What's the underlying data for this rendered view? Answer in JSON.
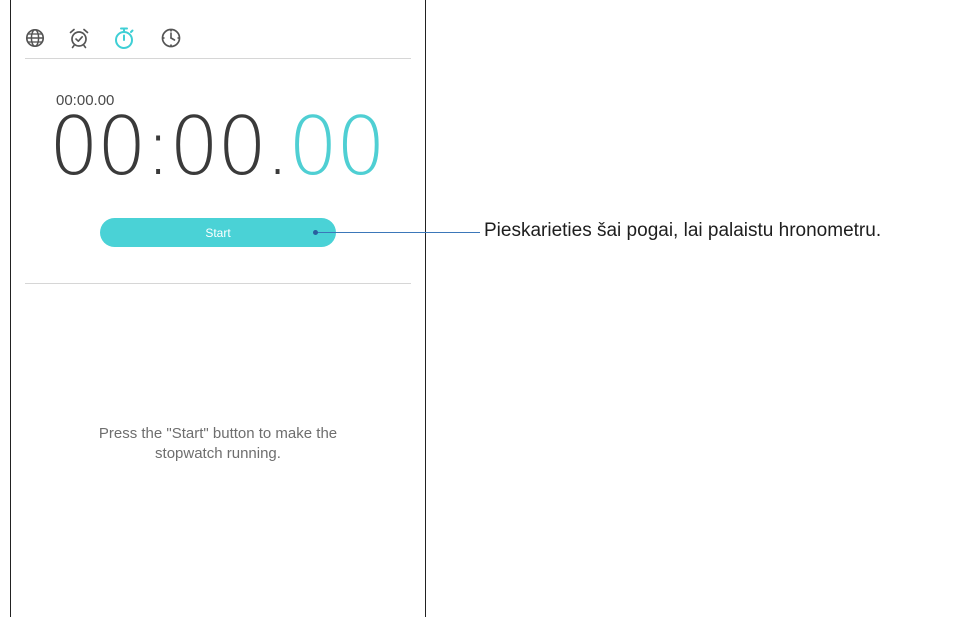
{
  "tabs": [
    {
      "icon": "globe-icon",
      "label": "World clock",
      "active": false
    },
    {
      "icon": "alarm-icon",
      "label": "Alarm",
      "active": false
    },
    {
      "icon": "stopwatch-icon",
      "label": "Stopwatch",
      "active": true
    },
    {
      "icon": "timer-icon",
      "label": "Timer",
      "active": false
    }
  ],
  "stopwatch": {
    "small_time": "00:00.00",
    "main_time": "00:00.",
    "centiseconds": "00",
    "start_label": "Start",
    "hint": "Press the \"Start\" button to make the stopwatch running."
  },
  "callout": {
    "text": "Pieskarieties šai pogai, lai palaistu hronometru."
  },
  "colors": {
    "accent": "#4ad2d6",
    "icon": "#555555",
    "callout_line": "#3b77b9"
  }
}
